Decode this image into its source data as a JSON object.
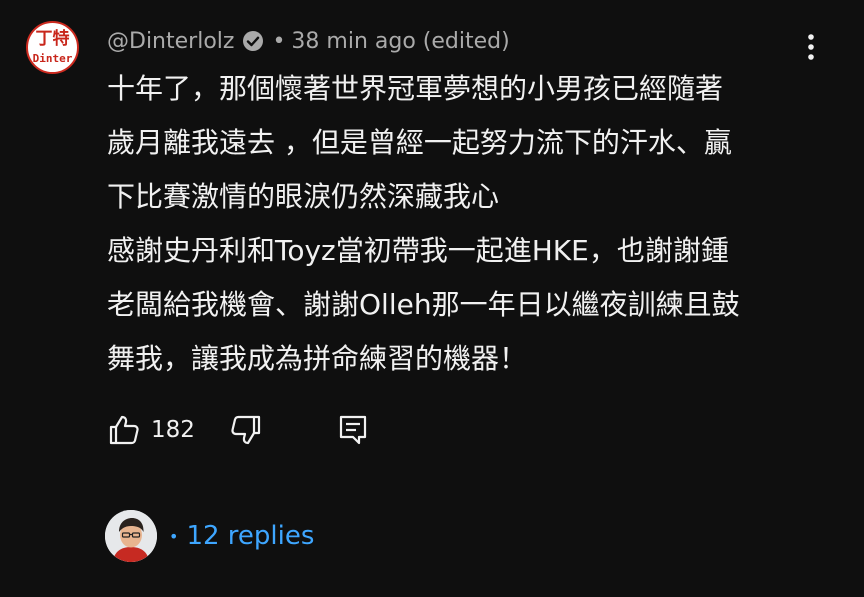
{
  "comment": {
    "avatar": {
      "logo_top": "丁特",
      "logo_bottom": "Dinter"
    },
    "author": "@Dinterlolz",
    "verified_icon": "verified-check-icon",
    "separator": "•",
    "timestamp": "38 min ago (edited)",
    "more_icon": "more-vertical-icon",
    "text_lines": [
      "十年了，那個懷著世界冠軍夢想的小男孩已經隨著",
      "歲月離我遠去 ，但是曾經一起努力流下的汗水、贏",
      "下比賽激情的眼淚仍然深藏我心",
      "感謝史丹利和Toyz當初帶我一起進HKE，也謝謝鍾",
      "老闆給我機會、謝謝Olleh那一年日以繼夜訓練且鼓",
      "舞我，讓我成為拼命練習的機器！"
    ],
    "actions": {
      "like_icon": "thumbs-up-icon",
      "like_count": "182",
      "dislike_icon": "thumbs-down-icon",
      "reply_icon": "reply-comment-icon"
    },
    "replies": {
      "bullet": "•",
      "label": "12 replies"
    },
    "colors": {
      "background": "#0f0f0f",
      "text": "#f1f1f1",
      "secondary": "#aaaaaa",
      "link": "#3ea6ff",
      "brand_red": "#c8261b"
    }
  }
}
